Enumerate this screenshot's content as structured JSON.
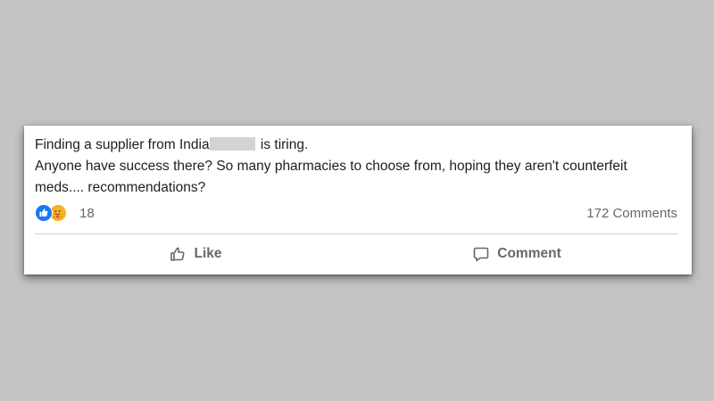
{
  "post": {
    "line1_start": "Finding a supplier from India",
    "line1_end": " is tiring.",
    "line2": "Anyone have success there? So many pharmacies to choose from, hoping they aren't counterfeit meds.... recommendations?"
  },
  "reactions": {
    "count": "18",
    "icons": [
      "like-icon",
      "care-icon"
    ],
    "like_color": "#1877f2",
    "care_color": "#f7b125"
  },
  "comments": {
    "count_label": "172 Comments"
  },
  "actions": {
    "like_label": "Like",
    "comment_label": "Comment"
  }
}
